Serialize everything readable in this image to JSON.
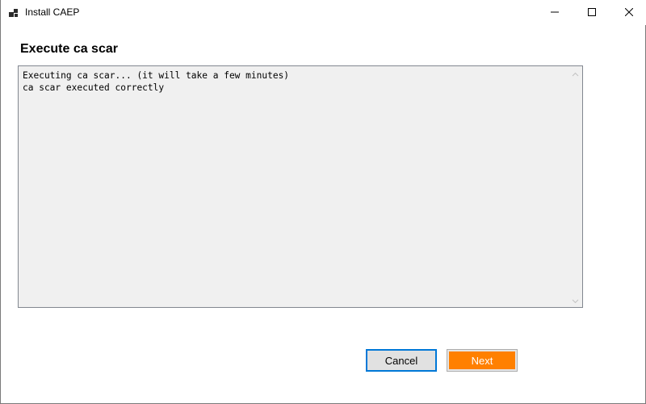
{
  "window": {
    "title": "Install CAEP",
    "controls": {
      "minimize_icon": "minimize-icon",
      "maximize_icon": "maximize-icon",
      "close_icon": "close-icon"
    }
  },
  "page": {
    "heading": "Execute ca scar"
  },
  "log": {
    "lines": [
      "Executing ca scar... (it will take a few minutes)",
      "ca scar executed correctly"
    ]
  },
  "buttons": {
    "cancel_label": "Cancel",
    "next_label": "Next"
  },
  "colors": {
    "next_background": "#ff8000",
    "cancel_focus_border": "#0078d7",
    "log_background": "#f0f0f0"
  }
}
